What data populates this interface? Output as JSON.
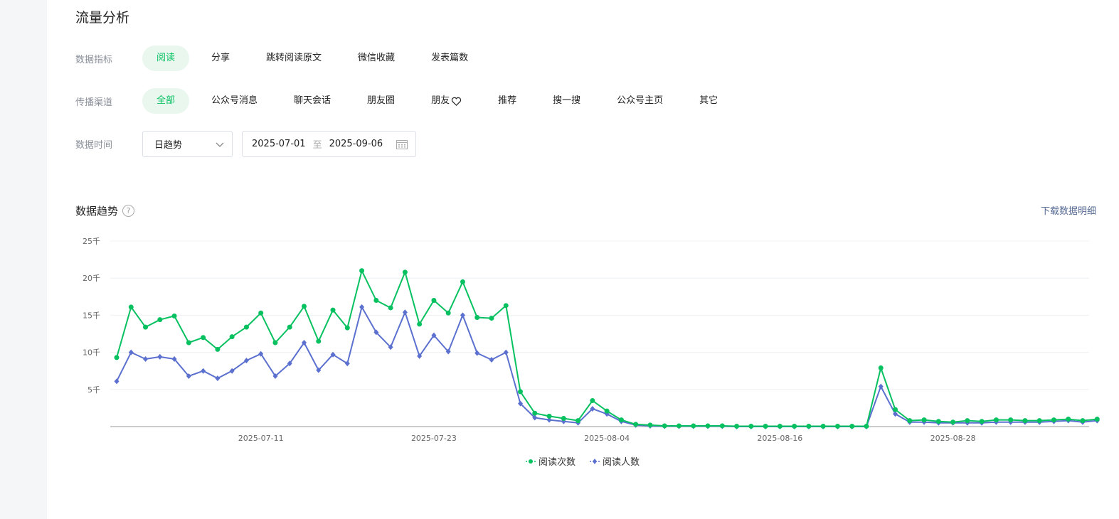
{
  "header": {
    "title": "流量分析"
  },
  "filters": {
    "metric": {
      "label": "数据指标",
      "options": [
        "阅读",
        "分享",
        "跳转阅读原文",
        "微信收藏",
        "发表篇数"
      ],
      "active": 0
    },
    "channel": {
      "label": "传播渠道",
      "options": [
        "全部",
        "公众号消息",
        "聊天会话",
        "朋友圈",
        "朋友",
        "推荐",
        "搜一搜",
        "公众号主页",
        "其它"
      ],
      "active": 0
    },
    "time": {
      "label": "数据时间",
      "granularity": "日趋势",
      "start": "2025-07-01",
      "sep": "至",
      "end": "2025-09-06"
    }
  },
  "section": {
    "title": "数据趋势",
    "help_glyph": "?",
    "download": "下载数据明细"
  },
  "colors": {
    "accent": "#07c160",
    "series1": "#07c160",
    "series2": "#5b70cf"
  },
  "chart_data": {
    "type": "line",
    "x": [
      "2025-07-01",
      "2025-07-02",
      "2025-07-03",
      "2025-07-04",
      "2025-07-05",
      "2025-07-06",
      "2025-07-07",
      "2025-07-08",
      "2025-07-09",
      "2025-07-10",
      "2025-07-11",
      "2025-07-12",
      "2025-07-13",
      "2025-07-14",
      "2025-07-15",
      "2025-07-16",
      "2025-07-17",
      "2025-07-18",
      "2025-07-19",
      "2025-07-20",
      "2025-07-21",
      "2025-07-22",
      "2025-07-23",
      "2025-07-24",
      "2025-07-25",
      "2025-07-26",
      "2025-07-27",
      "2025-07-28",
      "2025-07-29",
      "2025-07-30",
      "2025-07-31",
      "2025-08-01",
      "2025-08-02",
      "2025-08-03",
      "2025-08-04",
      "2025-08-05",
      "2025-08-06",
      "2025-08-07",
      "2025-08-08",
      "2025-08-09",
      "2025-08-10",
      "2025-08-11",
      "2025-08-12",
      "2025-08-13",
      "2025-08-14",
      "2025-08-15",
      "2025-08-16",
      "2025-08-17",
      "2025-08-18",
      "2025-08-19",
      "2025-08-20",
      "2025-08-21",
      "2025-08-22",
      "2025-08-23",
      "2025-08-24",
      "2025-08-25",
      "2025-08-26",
      "2025-08-27",
      "2025-08-28",
      "2025-08-29",
      "2025-08-30",
      "2025-08-31",
      "2025-09-01",
      "2025-09-02",
      "2025-09-03",
      "2025-09-04",
      "2025-09-05",
      "2025-09-06"
    ],
    "series": [
      {
        "name": "阅读次数",
        "marker": "circle",
        "values": [
          9300,
          16100,
          13400,
          14400,
          14900,
          11300,
          12000,
          10400,
          12100,
          13400,
          15300,
          11300,
          13400,
          16200,
          11500,
          15700,
          13300,
          21000,
          17000,
          16000,
          20800,
          13800,
          17000,
          15300,
          19500,
          14700,
          14600,
          16300,
          4700,
          1800,
          1400,
          1100,
          800,
          3500,
          2100,
          900,
          300,
          200,
          100,
          100,
          100,
          100,
          100,
          50,
          50,
          50,
          50,
          50,
          50,
          50,
          50,
          50,
          50,
          7900,
          2300,
          800,
          900,
          700,
          600,
          800,
          700,
          900,
          900,
          800,
          800,
          900,
          1000,
          800,
          1000
        ],
        "_note": ""
      },
      {
        "name": "阅读人数",
        "marker": "diamond",
        "values": [
          6100,
          10000,
          9100,
          9400,
          9100,
          6800,
          7500,
          6500,
          7500,
          8900,
          9800,
          6800,
          8500,
          11300,
          7600,
          9700,
          8500,
          16100,
          12700,
          10700,
          15400,
          9500,
          12300,
          10100,
          15000,
          9900,
          9000,
          10000,
          3100,
          1200,
          900,
          700,
          500,
          2400,
          1700,
          700,
          200,
          100,
          50,
          50,
          50,
          50,
          50,
          0,
          0,
          0,
          0,
          0,
          0,
          0,
          0,
          0,
          0,
          5400,
          1700,
          600,
          600,
          500,
          500,
          500,
          500,
          600,
          600,
          600,
          600,
          700,
          800,
          600,
          800
        ]
      }
    ],
    "x_ticks": [
      "2025-07-11",
      "2025-07-23",
      "2025-08-04",
      "2025-08-16",
      "2025-08-28"
    ],
    "y_ticks": [
      "5千",
      "10千",
      "15千",
      "20千",
      "25千"
    ],
    "ylim": [
      0,
      25000
    ],
    "grid": true,
    "legend_position": "bottom"
  }
}
